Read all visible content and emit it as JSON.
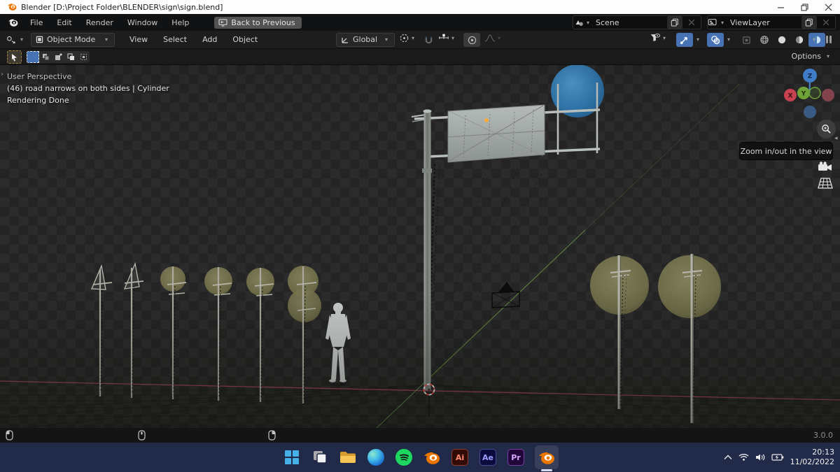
{
  "window": {
    "title": "Blender [D:\\Project Folder\\BLENDER\\sign\\sign.blend]"
  },
  "topbar": {
    "menus": [
      "File",
      "Edit",
      "Render",
      "Window",
      "Help"
    ],
    "back_label": "Back to Previous",
    "scene_value": "Scene",
    "viewlayer_value": "ViewLayer"
  },
  "header": {
    "mode": "Object Mode",
    "menus": [
      "View",
      "Select",
      "Add",
      "Object"
    ],
    "orientation": "Global"
  },
  "toolbar": {
    "options_label": "Options"
  },
  "viewport": {
    "overlay": [
      "User Perspective",
      "(46) road narrows on both sides | Cylinder",
      "Rendering Done"
    ],
    "tooltip": "Zoom in/out in the view",
    "gizmo": {
      "x": "X",
      "y": "Y",
      "z": "Z"
    }
  },
  "statusbar": {
    "version": "3.0.0"
  },
  "taskbar": {
    "time": "20:13",
    "date": "11/02/2022",
    "badges": {
      "illustrator": "Ai",
      "aftereffects": "Ae",
      "premiere": "Pr"
    }
  },
  "colors": {
    "accent": "#4772b3",
    "taskbar": "#212a48",
    "sign_blue": "#2f77ad",
    "sign_olive": "#7c7a52",
    "axis_x": "#a8455c",
    "axis_y": "#6e9e45"
  }
}
